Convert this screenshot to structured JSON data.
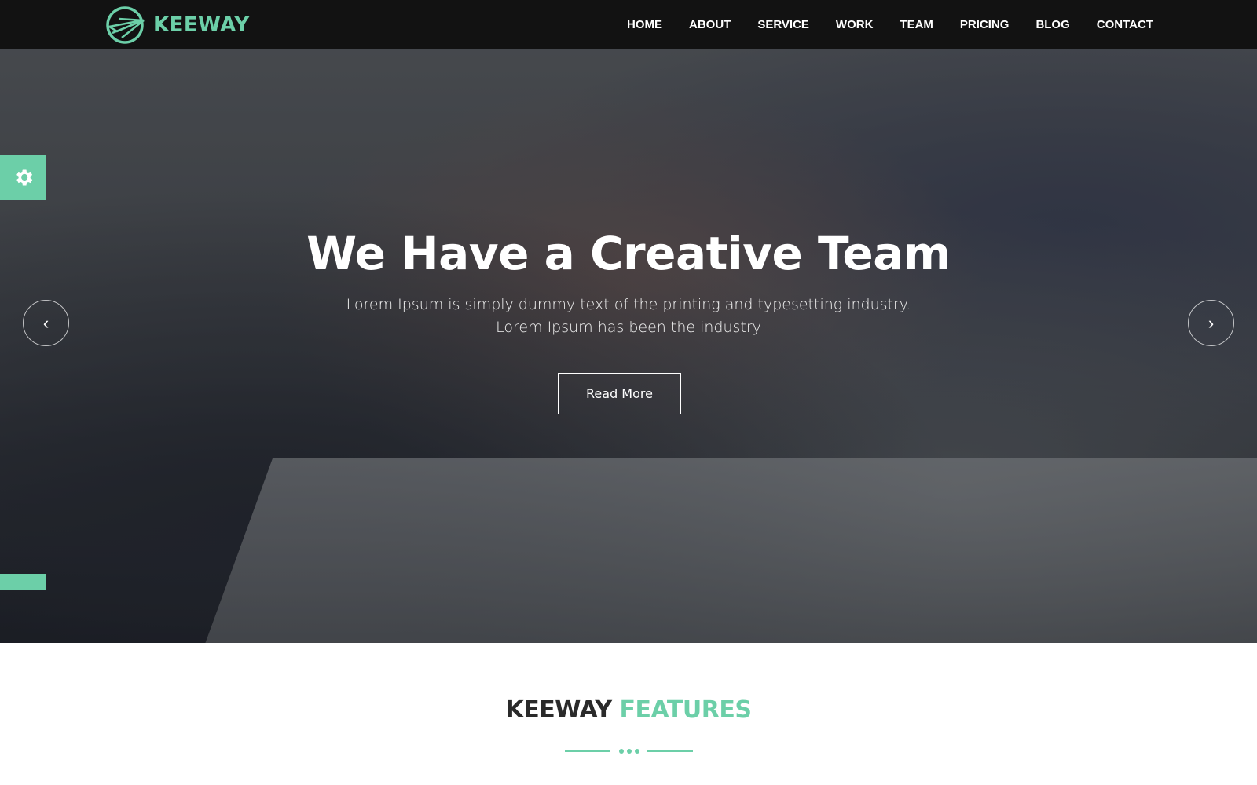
{
  "brand": {
    "name": "KEEWAY",
    "accent_color": "#6ccfa8"
  },
  "nav": {
    "items": [
      {
        "label": "HOME"
      },
      {
        "label": "ABOUT"
      },
      {
        "label": "SERVICE"
      },
      {
        "label": "WORK"
      },
      {
        "label": "TEAM"
      },
      {
        "label": "PRICING"
      },
      {
        "label": "BLOG"
      },
      {
        "label": "CONTACT"
      }
    ]
  },
  "hero": {
    "title": "We Have a Creative Team",
    "subtitle_line1": "Lorem Ipsum is simply dummy text of the printing and typesetting industry.",
    "subtitle_line2": "Lorem Ipsum has been the industry",
    "button_label": "Read More",
    "prev_icon": "‹",
    "next_icon": "›"
  },
  "features": {
    "title_dark": "KEEWAY",
    "title_accent": "FEATURES"
  }
}
